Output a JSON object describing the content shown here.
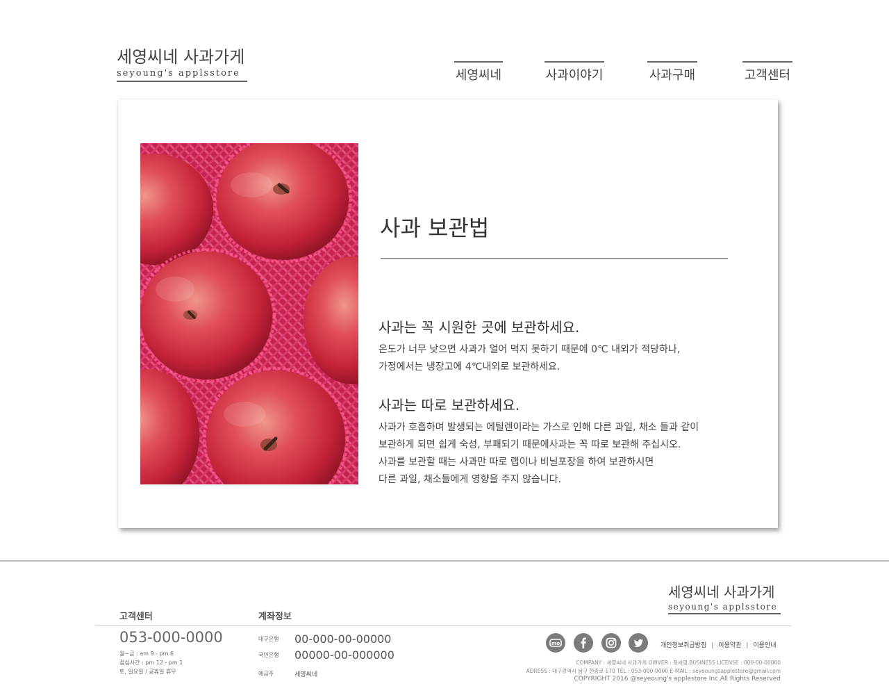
{
  "header": {
    "logo_title": "세영씨네 사과가게",
    "logo_sub": "seyoung's applsstore",
    "nav": [
      "세영씨네",
      "사과이야기",
      "사과구매",
      "고객센터"
    ]
  },
  "article": {
    "heading": "사과 보관법",
    "sections": [
      {
        "title": "사과는 꼭 시원한 곳에 보관하세요.",
        "lines": [
          "온도가 너무 낮으면 사과가 얼어 먹지 못하기 때문에 0℃ 내외가 적당하나,",
          "가정에서는 냉장고에 4℃내외로 보관하세요."
        ]
      },
      {
        "title": "사과는 따로 보관하세요.",
        "lines": [
          "사과가 호흡하며 발생되는 에틸렌이라는 가스로 인해 다른 과일, 채소 들과 같이",
          "보관하게 되면 쉽게 숙성, 부패되기 때문에사과는 꼭 따로 보관해 주십시오.",
          "사과를 보관할 때는 사과만 따로 랩이나 비닐포장을 하여 보관하시면",
          "다른 과일, 채소들에게 영향을 주지 않습니다."
        ]
      }
    ]
  },
  "footer": {
    "logo_title": "세영씨네 사과가게",
    "logo_sub": "seyoung's applsstore",
    "customer_center": {
      "label": "고객센터",
      "phone": "053-000-0000",
      "hours": [
        "월~금 : am 9 - pm 6",
        "점심시간 : pm 12 - pm 1",
        "토, 일요일 / 공휴일 휴무"
      ]
    },
    "account": {
      "label": "계좌정보",
      "rows": [
        {
          "bank": "대구은행",
          "number": "00-000-00-00000"
        },
        {
          "bank": "국민은행",
          "number": "00000-00-000000"
        }
      ],
      "holder_label": "예금주",
      "holder_name": "세영씨네"
    },
    "social": [
      "mo-icon",
      "facebook-icon",
      "instagram-icon",
      "twitter-icon"
    ],
    "links": [
      "개인정보취급방침",
      "이용약관",
      "이용안내"
    ],
    "info": {
      "line1": "COMPANY : 세영씨네 사과가게  OWVER : 최세영  BUSINESS LICENSE : 000-00-00000",
      "line2": "ADRESS : 대구광역시 남구 현충로 170  TEL : 053-000-0000  E-MAIL : seyeoungsapplestore@gmail.com",
      "line3": "COPYRIGHT 2016 @seyeoung's applestore Inc.All Rights Reserved"
    }
  },
  "colors": {
    "text": "#333333",
    "rule": "#999999",
    "social_bg": "#7b7b7b",
    "apple_red": "#c8263c",
    "net_pink": "#e8386a"
  }
}
